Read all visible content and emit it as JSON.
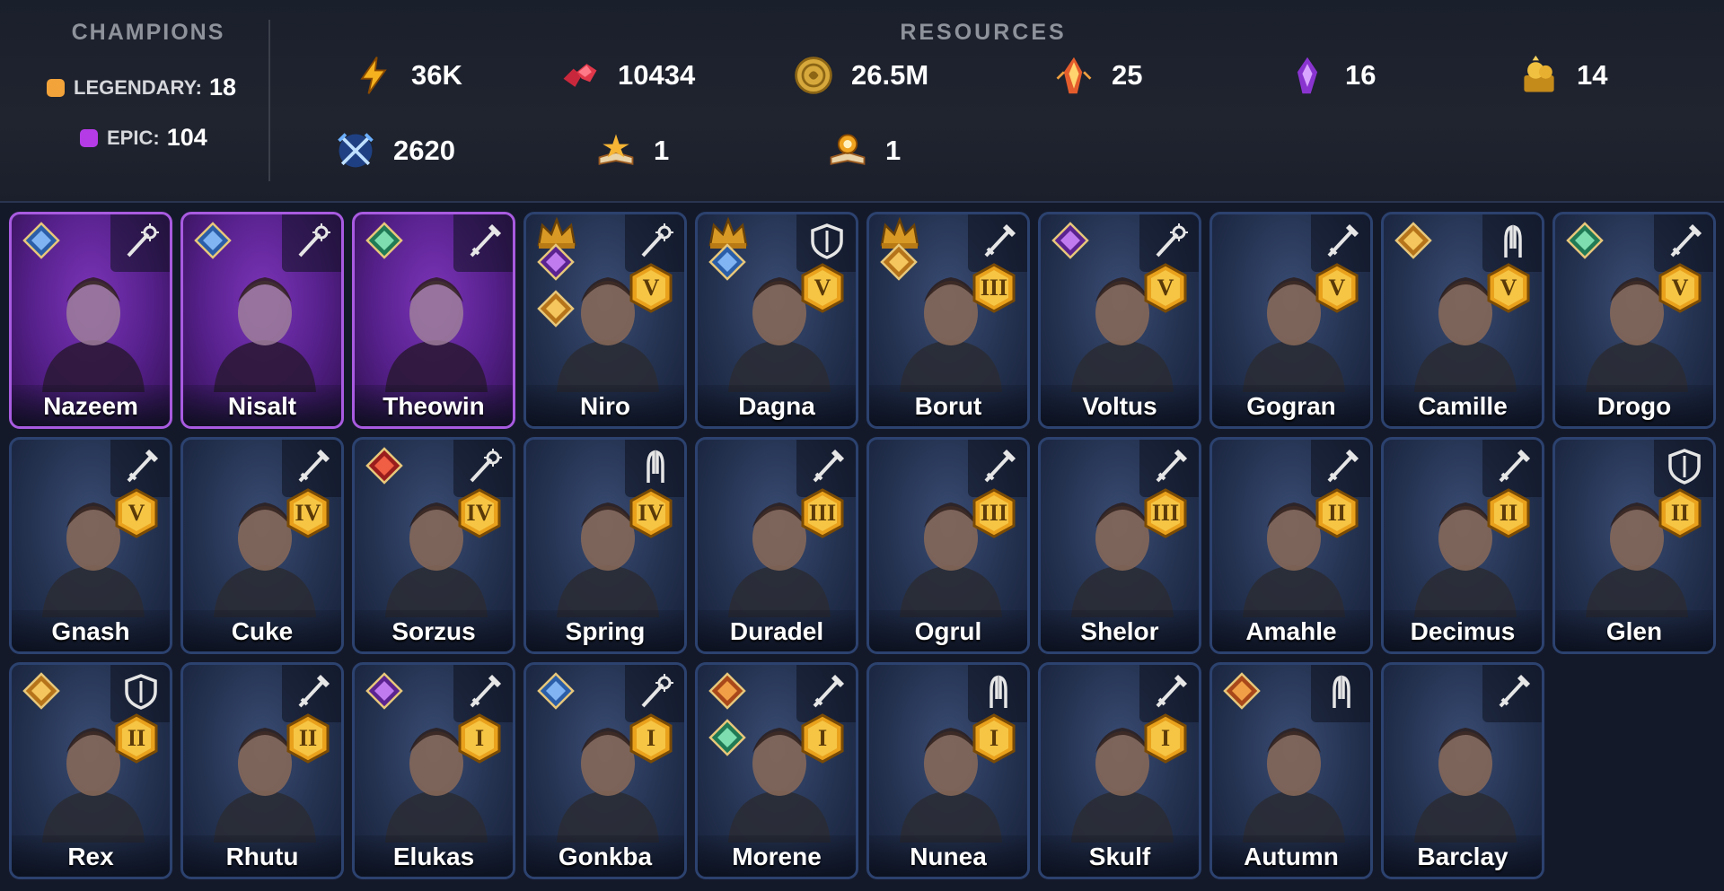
{
  "champions_panel": {
    "title": "CHAMPIONS",
    "legendary_label": "LEGENDARY:",
    "legendary_count": "18",
    "epic_label": "EPIC:",
    "epic_count": "104",
    "legendary_color": "#f2a33a",
    "epic_color": "#b43be6"
  },
  "resources": {
    "title": "RESOURCES",
    "items": [
      {
        "icon": "energy-icon",
        "value": "36K"
      },
      {
        "icon": "rubies-icon",
        "value": "10434"
      },
      {
        "icon": "silver-coin-icon",
        "value": "26.5M"
      },
      {
        "icon": "sacred-shard-icon",
        "value": "25"
      },
      {
        "icon": "void-shard-icon",
        "value": "16"
      },
      {
        "icon": "gold-chicken-icon",
        "value": "14"
      },
      {
        "icon": "arena-tokens-icon",
        "value": "2620"
      },
      {
        "icon": "legendary-tome-icon",
        "value": "1"
      },
      {
        "icon": "masteries-scroll-icon",
        "value": "1"
      }
    ]
  },
  "champions": [
    {
      "name": "Nazeem",
      "rarity": "epic",
      "affinity": "magic",
      "role": "support",
      "rank": ""
    },
    {
      "name": "Nisalt",
      "rarity": "epic",
      "affinity": "magic",
      "role": "support",
      "rank": ""
    },
    {
      "name": "Theowin",
      "rarity": "epic",
      "affinity": "force",
      "role": "attack",
      "rank": ""
    },
    {
      "name": "Niro",
      "rarity": "legendary",
      "affinity": "void",
      "role": "support",
      "rank": "V",
      "crown": true,
      "extra": "spirit"
    },
    {
      "name": "Dagna",
      "rarity": "legendary",
      "affinity": "magic",
      "role": "defense",
      "rank": "V",
      "crown": true
    },
    {
      "name": "Borut",
      "rarity": "legendary",
      "affinity": "spirit",
      "role": "attack",
      "rank": "III",
      "crown": true
    },
    {
      "name": "Voltus",
      "rarity": "legendary",
      "affinity": "void",
      "role": "support",
      "rank": "V"
    },
    {
      "name": "Gogran",
      "rarity": "legendary",
      "affinity": "",
      "role": "attack",
      "rank": "V"
    },
    {
      "name": "Camille",
      "rarity": "legendary",
      "affinity": "spirit",
      "role": "hp",
      "rank": "V"
    },
    {
      "name": "Drogo",
      "rarity": "legendary",
      "affinity": "force",
      "role": "attack",
      "rank": "V"
    },
    {
      "name": "Gnash",
      "rarity": "legendary",
      "affinity": "",
      "role": "attack",
      "rank": "V"
    },
    {
      "name": "Cuke",
      "rarity": "legendary",
      "affinity": "",
      "role": "attack",
      "rank": "IV"
    },
    {
      "name": "Sorzus",
      "rarity": "legendary",
      "affinity": "force-red",
      "role": "support",
      "rank": "IV"
    },
    {
      "name": "Spring",
      "rarity": "legendary",
      "affinity": "",
      "role": "hp",
      "rank": "IV"
    },
    {
      "name": "Duradel",
      "rarity": "legendary",
      "affinity": "",
      "role": "attack",
      "rank": "III"
    },
    {
      "name": "Ogrul",
      "rarity": "legendary",
      "affinity": "",
      "role": "attack",
      "rank": "III"
    },
    {
      "name": "Shelor",
      "rarity": "legendary",
      "affinity": "",
      "role": "attack",
      "rank": "III"
    },
    {
      "name": "Amahle",
      "rarity": "legendary",
      "affinity": "",
      "role": "attack",
      "rank": "II"
    },
    {
      "name": "Decimus",
      "rarity": "legendary",
      "affinity": "",
      "role": "attack",
      "rank": "II"
    },
    {
      "name": "Glen",
      "rarity": "legendary",
      "affinity": "",
      "role": "defense",
      "rank": "II"
    },
    {
      "name": "Rex",
      "rarity": "legendary",
      "affinity": "spirit",
      "role": "defense",
      "rank": "II"
    },
    {
      "name": "Rhutu",
      "rarity": "legendary",
      "affinity": "",
      "role": "attack",
      "rank": "II"
    },
    {
      "name": "Elukas",
      "rarity": "legendary",
      "affinity": "void",
      "role": "attack",
      "rank": "I"
    },
    {
      "name": "Gonkba",
      "rarity": "legendary",
      "affinity": "magic",
      "role": "support",
      "rank": "I"
    },
    {
      "name": "Morene",
      "rarity": "legendary",
      "affinity": "fire",
      "role": "attack",
      "rank": "I",
      "extra": "force"
    },
    {
      "name": "Nunea",
      "rarity": "legendary",
      "affinity": "",
      "role": "hp",
      "rank": "I"
    },
    {
      "name": "Skulf",
      "rarity": "legendary",
      "affinity": "",
      "role": "attack",
      "rank": "I"
    },
    {
      "name": "Autumn",
      "rarity": "legendary",
      "affinity": "fire",
      "role": "hp",
      "rank": ""
    },
    {
      "name": "Barclay",
      "rarity": "legendary",
      "affinity": "",
      "role": "attack",
      "rank": ""
    }
  ]
}
